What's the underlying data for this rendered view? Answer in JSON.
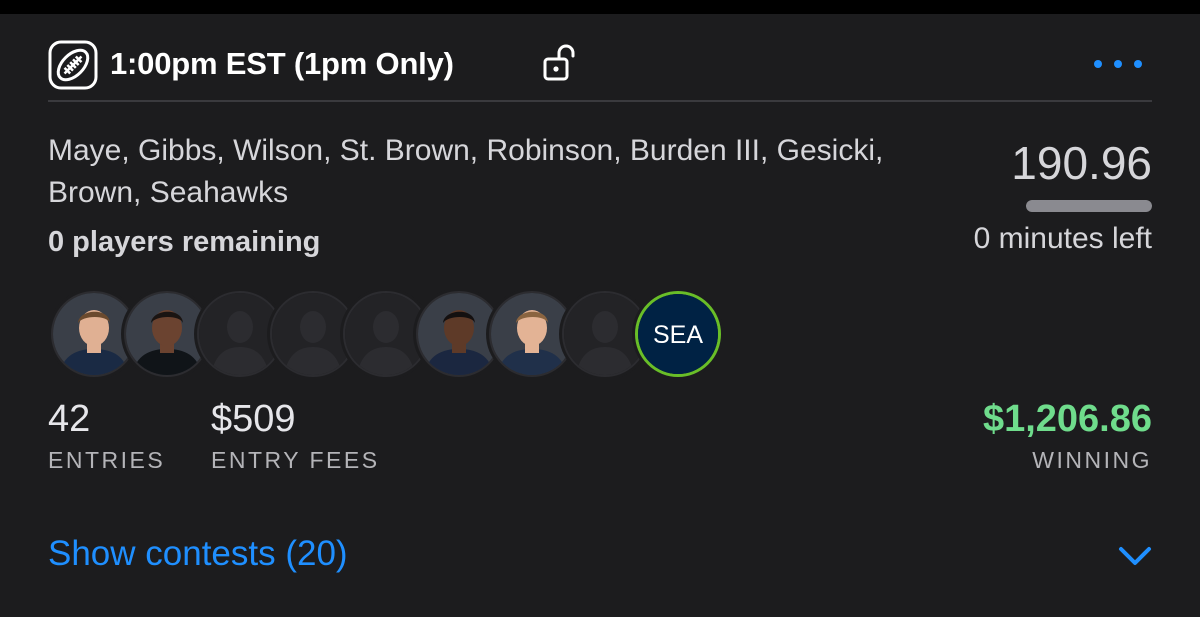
{
  "header": {
    "title": "1:00pm EST (1pm Only)",
    "sport_icon": "football-icon",
    "status_icon": "unlocked-icon",
    "menu_icon": "more-dots-icon"
  },
  "lineup": {
    "players_text": "Maye, Gibbs, Wilson, St. Brown, Robinson, Burden III, Gesicki, Brown, Seahawks",
    "players_remaining": "0 players remaining",
    "avatars": [
      {
        "type": "photo",
        "skin": "#e0b093",
        "hair": "#6b4a2e",
        "jersey": "#1a2a44"
      },
      {
        "type": "photo",
        "skin": "#6b4330",
        "hair": "#1a1412",
        "jersey": "#101418"
      },
      {
        "type": "placeholder"
      },
      {
        "type": "placeholder"
      },
      {
        "type": "placeholder"
      },
      {
        "type": "photo",
        "skin": "#5e3a28",
        "hair": "#141010",
        "jersey": "#1b2740"
      },
      {
        "type": "photo",
        "skin": "#e3b395",
        "hair": "#8a6440",
        "jersey": "#20304a"
      },
      {
        "type": "placeholder"
      },
      {
        "type": "team",
        "abbr": "SEA"
      }
    ]
  },
  "score": {
    "points": "190.96",
    "progress_fraction": 1.0,
    "time_left": "0 minutes left"
  },
  "stats": {
    "entries_value": "42",
    "entries_label": "ENTRIES",
    "fees_value": "$509",
    "fees_label": "ENTRY FEES",
    "winning_value": "$1,206.86",
    "winning_label": "WINNING"
  },
  "footer": {
    "show_contests": "Show contests (20)",
    "toggle_icon": "chevron-down-icon"
  },
  "colors": {
    "background": "#1c1c1e",
    "accent": "#1f8fff",
    "winning": "#6fdc8c",
    "seahawks_navy": "#002244",
    "seahawks_green": "#69be28"
  }
}
